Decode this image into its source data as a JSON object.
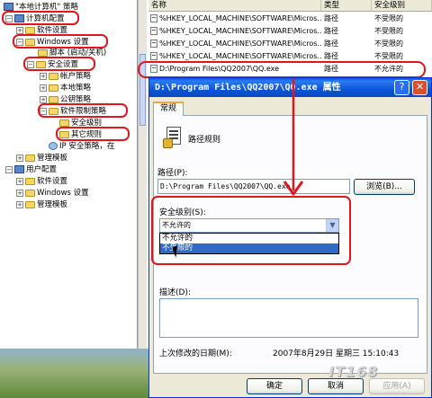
{
  "tree": {
    "items": [
      {
        "label": "\"本地计算机\" 策略"
      },
      {
        "label": "计算机配置"
      },
      {
        "label": "软件设置"
      },
      {
        "label": "Windows 设置"
      },
      {
        "label": "脚本 (启动/关机)"
      },
      {
        "label": "安全设置"
      },
      {
        "label": "帐户策略"
      },
      {
        "label": "本地策略"
      },
      {
        "label": "公钥策略"
      },
      {
        "label": "软件限制策略"
      },
      {
        "label": "安全级别"
      },
      {
        "label": "其它规则"
      },
      {
        "label": "IP 安全策略，在"
      },
      {
        "label": "管理模板"
      },
      {
        "label": "用户配置"
      },
      {
        "label": "软件设置"
      },
      {
        "label": "Windows 设置"
      },
      {
        "label": "管理模板"
      }
    ]
  },
  "list": {
    "headers": {
      "name": "名称",
      "type": "类型",
      "level": "安全级别"
    },
    "rows": [
      {
        "name": "%HKEY_LOCAL_MACHINE\\SOFTWARE\\Micros...",
        "type": "路径",
        "level": "不受限的"
      },
      {
        "name": "%HKEY_LOCAL_MACHINE\\SOFTWARE\\Micros...",
        "type": "路径",
        "level": "不受限的"
      },
      {
        "name": "%HKEY_LOCAL_MACHINE\\SOFTWARE\\Micros...",
        "type": "路径",
        "level": "不受限的"
      },
      {
        "name": "%HKEY_LOCAL_MACHINE\\SOFTWARE\\Micros...",
        "type": "路径",
        "level": "不受限的"
      },
      {
        "name": "D:\\Program Files\\QQ2007\\QQ.exe",
        "type": "路径",
        "level": "不允许的"
      }
    ]
  },
  "dialog": {
    "title": "D:\\Program Files\\QQ2007\\QQ.exe 属性",
    "help_label": "?",
    "close_label": "✕",
    "tab_general": "常规",
    "rule_heading": "路径规则",
    "path_label": "路径(P):",
    "path_value": "D:\\Program Files\\QQ2007\\QQ.exe",
    "browse_label": "浏览(B)...",
    "security_label": "安全级别(S):",
    "security_selected": "不允许的",
    "security_options": [
      "不允许的",
      "不受限的"
    ],
    "description_label": "描述(D):",
    "description_value": "",
    "modified_label": "上次修改的日期(M):",
    "modified_value": "2007年8月29日 星期三   15:10:43",
    "ok_label": "确定",
    "cancel_label": "取消",
    "apply_label": "应用(A)"
  },
  "watermark": "IT168"
}
